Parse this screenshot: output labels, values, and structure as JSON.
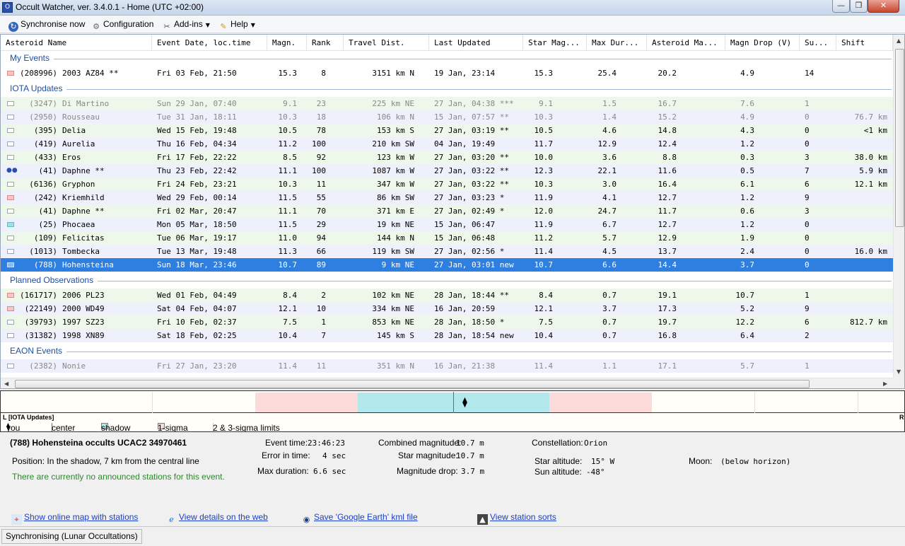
{
  "window": {
    "title": "Occult Watcher, ver. 3.4.0.1 - Home (UTC +02:00)",
    "minimize": "—",
    "maximize": "❐",
    "close": "✕"
  },
  "toolbar": {
    "sync_label": "Synchronise now",
    "config_label": "Configuration",
    "addins_label": "Add-ins",
    "help_label": "Help"
  },
  "columns": [
    "Asteroid Name",
    "Event Date, loc.time",
    "Magn.",
    "Rank",
    "Travel Dist.",
    "Last Updated",
    "Star Mag...",
    "Max Dur...",
    "Asteroid Ma...",
    "Magn Drop (V)",
    "Su...",
    "Shift"
  ],
  "groups": [
    {
      "name": "My Events",
      "rows": [
        {
          "marker": "pink",
          "color": "white",
          "gray": false,
          "name": "(208996) 2003 AZ84 **",
          "date": "Fri 03 Feb, 21:50",
          "magn": "15.3",
          "rank": "8",
          "dist": "3151 km N",
          "updated": "19 Jan, 23:14",
          "starmag": "15.3",
          "maxdur": "25.4",
          "astmag": "20.2",
          "drop": "4.9",
          "su": "14",
          "shift": ""
        }
      ]
    },
    {
      "name": "IOTA Updates",
      "rows": [
        {
          "marker": "box",
          "color": "green",
          "gray": true,
          "name": "(3247) Di Martino",
          "date": "Sun 29 Jan, 07:40",
          "magn": "9.1",
          "rank": "23",
          "dist": "225 km NE",
          "updated": "27 Jan, 04:38 ***",
          "starmag": "9.1",
          "maxdur": "1.5",
          "astmag": "16.7",
          "drop": "7.6",
          "su": "1",
          "shift": ""
        },
        {
          "marker": "box",
          "color": "blue",
          "gray": true,
          "name": "(2950) Rousseau",
          "date": "Tue 31 Jan, 18:11",
          "magn": "10.3",
          "rank": "18",
          "dist": "106 km N",
          "updated": "15 Jan, 07:57 **",
          "starmag": "10.3",
          "maxdur": "1.4",
          "astmag": "15.2",
          "drop": "4.9",
          "su": "0",
          "shift": "76.7 km"
        },
        {
          "marker": "box",
          "color": "green",
          "gray": false,
          "name": "(395) Delia",
          "date": "Wed 15 Feb, 19:48",
          "magn": "10.5",
          "rank": "78",
          "dist": "153 km S",
          "updated": "27 Jan, 03:19 **",
          "starmag": "10.5",
          "maxdur": "4.6",
          "astmag": "14.8",
          "drop": "4.3",
          "su": "0",
          "shift": "<1 km"
        },
        {
          "marker": "box",
          "color": "blue",
          "gray": false,
          "name": "(419) Aurelia",
          "date": "Thu 16 Feb, 04:34",
          "magn": "11.2",
          "rank": "100",
          "dist": "210 km SW",
          "updated": "04 Jan, 19:49",
          "starmag": "11.7",
          "maxdur": "12.9",
          "astmag": "12.4",
          "drop": "1.2",
          "su": "0",
          "shift": ""
        },
        {
          "marker": "box",
          "color": "green",
          "gray": false,
          "name": "(433) Eros",
          "date": "Fri 17 Feb, 22:22",
          "magn": "8.5",
          "rank": "92",
          "dist": "123 km W",
          "updated": "27 Jan, 03:20 **",
          "starmag": "10.0",
          "maxdur": "3.6",
          "astmag": "8.8",
          "drop": "0.3",
          "su": "3",
          "shift": "38.0 km"
        },
        {
          "marker": "dots",
          "color": "blue",
          "gray": false,
          "name": "(41) Daphne **",
          "date": "Thu 23 Feb, 22:42",
          "magn": "11.1",
          "rank": "100",
          "dist": "1087 km W",
          "updated": "27 Jan, 03:22 **",
          "starmag": "12.3",
          "maxdur": "22.1",
          "astmag": "11.6",
          "drop": "0.5",
          "su": "7",
          "shift": "5.9 km"
        },
        {
          "marker": "box",
          "color": "green",
          "gray": false,
          "name": "(6136) Gryphon",
          "date": "Fri 24 Feb, 23:21",
          "magn": "10.3",
          "rank": "11",
          "dist": "347 km W",
          "updated": "27 Jan, 03:22 **",
          "starmag": "10.3",
          "maxdur": "3.0",
          "astmag": "16.4",
          "drop": "6.1",
          "su": "6",
          "shift": "12.1 km"
        },
        {
          "marker": "pink",
          "color": "blue",
          "gray": false,
          "name": "(242) Kriemhild",
          "date": "Wed 29 Feb, 00:14",
          "magn": "11.5",
          "rank": "55",
          "dist": "86 km SW",
          "updated": "27 Jan, 03:23 *",
          "starmag": "11.9",
          "maxdur": "4.1",
          "astmag": "12.7",
          "drop": "1.2",
          "su": "9",
          "shift": ""
        },
        {
          "marker": "box",
          "color": "green",
          "gray": false,
          "name": "(41) Daphne **",
          "date": "Fri 02 Mar, 20:47",
          "magn": "11.1",
          "rank": "70",
          "dist": "371 km E",
          "updated": "27 Jan, 02:49 *",
          "starmag": "12.0",
          "maxdur": "24.7",
          "astmag": "11.7",
          "drop": "0.6",
          "su": "3",
          "shift": ""
        },
        {
          "marker": "cyan",
          "color": "blue",
          "gray": false,
          "name": "(25) Phocaea",
          "date": "Mon 05 Mar, 18:50",
          "magn": "11.5",
          "rank": "29",
          "dist": "19 km NE",
          "updated": "15 Jan, 06:47",
          "starmag": "11.9",
          "maxdur": "6.7",
          "astmag": "12.7",
          "drop": "1.2",
          "su": "0",
          "shift": ""
        },
        {
          "marker": "box",
          "color": "green",
          "gray": false,
          "name": "(109) Felicitas",
          "date": "Tue 06 Mar, 19:17",
          "magn": "11.0",
          "rank": "94",
          "dist": "144 km N",
          "updated": "15 Jan, 06:48",
          "starmag": "11.2",
          "maxdur": "5.7",
          "astmag": "12.9",
          "drop": "1.9",
          "su": "0",
          "shift": ""
        },
        {
          "marker": "box",
          "color": "blue",
          "gray": false,
          "name": "(1013) Tombecka",
          "date": "Tue 13 Mar, 19:48",
          "magn": "11.3",
          "rank": "66",
          "dist": "119 km SW",
          "updated": "27 Jan, 02:56 *",
          "starmag": "11.4",
          "maxdur": "4.5",
          "astmag": "13.7",
          "drop": "2.4",
          "su": "0",
          "shift": "16.0 km"
        },
        {
          "marker": "selchk",
          "color": "sel",
          "gray": false,
          "name": "(788) Hohensteina",
          "date": "Sun 18 Mar, 23:46",
          "magn": "10.7",
          "rank": "89",
          "dist": "9 km NE",
          "updated": "27 Jan, 03:01 new",
          "starmag": "10.7",
          "maxdur": "6.6",
          "astmag": "14.4",
          "drop": "3.7",
          "su": "0",
          "shift": ""
        }
      ]
    },
    {
      "name": "Planned Observations",
      "rows": [
        {
          "marker": "pink",
          "color": "green",
          "gray": false,
          "name": "(161717) 2006 PL23",
          "date": "Wed 01 Feb, 04:49",
          "magn": "8.4",
          "rank": "2",
          "dist": "102 km NE",
          "updated": "28 Jan, 18:44 **",
          "starmag": "8.4",
          "maxdur": "0.7",
          "astmag": "19.1",
          "drop": "10.7",
          "su": "1",
          "shift": ""
        },
        {
          "marker": "pink",
          "color": "blue",
          "gray": false,
          "name": "(22149) 2000 WD49",
          "date": "Sat 04 Feb, 04:07",
          "magn": "12.1",
          "rank": "10",
          "dist": "334 km NE",
          "updated": "16 Jan, 20:59",
          "starmag": "12.1",
          "maxdur": "3.7",
          "astmag": "17.3",
          "drop": "5.2",
          "su": "9",
          "shift": ""
        },
        {
          "marker": "box",
          "color": "green",
          "gray": false,
          "name": "(39793) 1997 SZ23",
          "date": "Fri 10 Feb, 02:37",
          "magn": "7.5",
          "rank": "1",
          "dist": "853 km NE",
          "updated": "28 Jan, 18:50 *",
          "starmag": "7.5",
          "maxdur": "0.7",
          "astmag": "19.7",
          "drop": "12.2",
          "su": "6",
          "shift": "812.7 km"
        },
        {
          "marker": "box",
          "color": "blue",
          "gray": false,
          "name": "(31382) 1998 XN89",
          "date": "Sat 18 Feb, 02:25",
          "magn": "10.4",
          "rank": "7",
          "dist": "145 km S",
          "updated": "28 Jan, 18:54 new",
          "starmag": "10.4",
          "maxdur": "0.7",
          "astmag": "16.8",
          "drop": "6.4",
          "su": "2",
          "shift": ""
        }
      ]
    },
    {
      "name": "EAON Events",
      "rows": [
        {
          "marker": "box",
          "color": "blue",
          "gray": true,
          "name": "(2382) Nonie",
          "date": "Fri 27 Jan, 23:20",
          "magn": "11.4",
          "rank": "11",
          "dist": "351 km N",
          "updated": "16 Jan, 21:38",
          "starmag": "11.4",
          "maxdur": "1.1",
          "astmag": "17.1",
          "drop": "5.7",
          "su": "1",
          "shift": ""
        }
      ]
    }
  ],
  "band": {
    "left_label": "L [IOTA Updates]",
    "right_label": "R",
    "legend": {
      "you": "you",
      "center": "center",
      "shadow": "shadow",
      "sigma1": "1-sigma",
      "sigma23": "2 & 3-sigma limits"
    }
  },
  "details": {
    "title": "(788) Hohensteina occults UCAC2 34970461",
    "position": "Position:  In the shadow, 7 km from the central line",
    "stations": "There are currently no announced stations for this event.",
    "event_time_label": "Event time:",
    "event_time": "23:46:23",
    "error_label": "Error in time:",
    "error": "4 sec",
    "max_dur_label": "Max duration:",
    "max_dur": "6.6 sec",
    "comb_mag_label": "Combined magnitude:",
    "comb_mag": "10.7 m",
    "star_mag_label": "Star magnitude:",
    "star_mag": "10.7 m",
    "drop_label": "Magnitude drop:",
    "drop": "3.7 m",
    "const_label": "Constellation:",
    "const": "Orion",
    "star_alt_label": "Star altitude:",
    "star_alt": "15° W",
    "sun_alt_label": "Sun altitude:",
    "sun_alt": "-48°",
    "moon_label": "Moon:",
    "moon": "(below horizon)"
  },
  "links": {
    "map": "Show online map with stations",
    "web": "View details on the web",
    "kml": "Save 'Google Earth' kml file",
    "sorts": "View station sorts"
  },
  "status": {
    "text": "Synchronising (Lunar Occultations)"
  }
}
